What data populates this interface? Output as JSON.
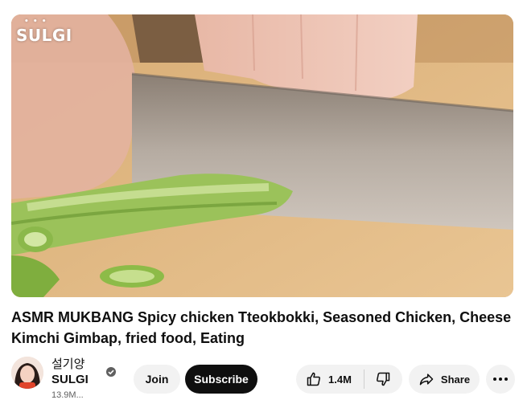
{
  "video": {
    "watermark": "SULGI",
    "watermark_dots": "• • •",
    "title": "ASMR MUKBANG Spicy chicken Tteokbokki, Seasoned Chicken, Cheese Kimchi Gimbap, fried food, Eating"
  },
  "channel": {
    "name_korean": "설기양",
    "name": "SULGI",
    "subscribers": "13.9M...",
    "verified": true
  },
  "actions": {
    "join_label": "Join",
    "subscribe_label": "Subscribe",
    "like_count": "1.4M",
    "share_label": "Share"
  },
  "icons": [
    "verified-icon",
    "thumbs-up-icon",
    "thumbs-down-icon",
    "share-arrow-icon",
    "more-dots-icon"
  ],
  "colors": {
    "subscribe_bg": "#0f0f0f",
    "pill_bg": "#f2f2f2",
    "secondary_text": "#606060"
  }
}
